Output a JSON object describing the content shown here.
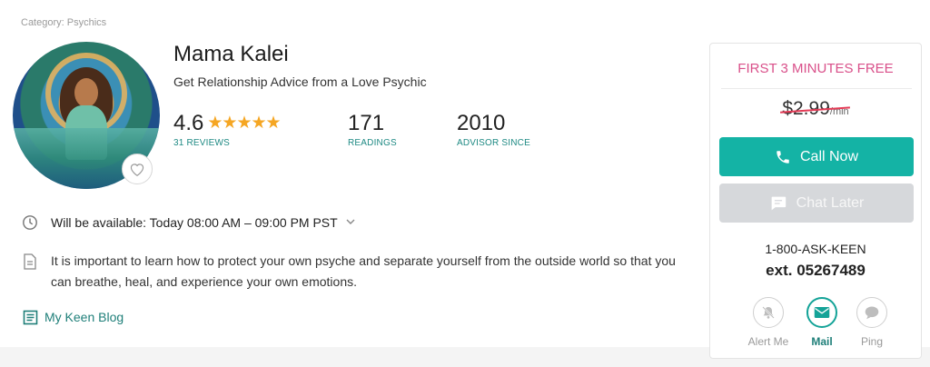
{
  "category": "Category: Psychics",
  "advisor": {
    "name": "Mama Kalei",
    "tagline": "Get Relationship Advice from a Love Psychic",
    "rating": "4.6",
    "stars": "★★★★★",
    "rating_value": 4.6,
    "reviews_label": "31 REVIEWS",
    "readings": "171",
    "readings_label": "READINGS",
    "since": "2010",
    "since_label": "ADVISOR SINCE"
  },
  "availability": "Will be available: Today 08:00 AM – 09:00 PM PST",
  "description": "It is important to learn how to protect your own psyche and separate yourself from the outside world so that you can breathe, heal, and experience your own emotions.",
  "blog_link": "My Keen Blog",
  "panel": {
    "promo": "FIRST 3 MINUTES FREE",
    "price": "$2.99",
    "price_unit": "/min",
    "call_label": "Call Now",
    "chat_label": "Chat Later",
    "phone": "1-800-ASK-KEEN",
    "ext": "ext. 05267489",
    "actions": [
      "Alert Me",
      "Mail",
      "Ping"
    ]
  },
  "colors": {
    "accent": "#14b3a5",
    "promo": "#d9508a",
    "link": "#1f7f79",
    "star": "#f5a623"
  }
}
